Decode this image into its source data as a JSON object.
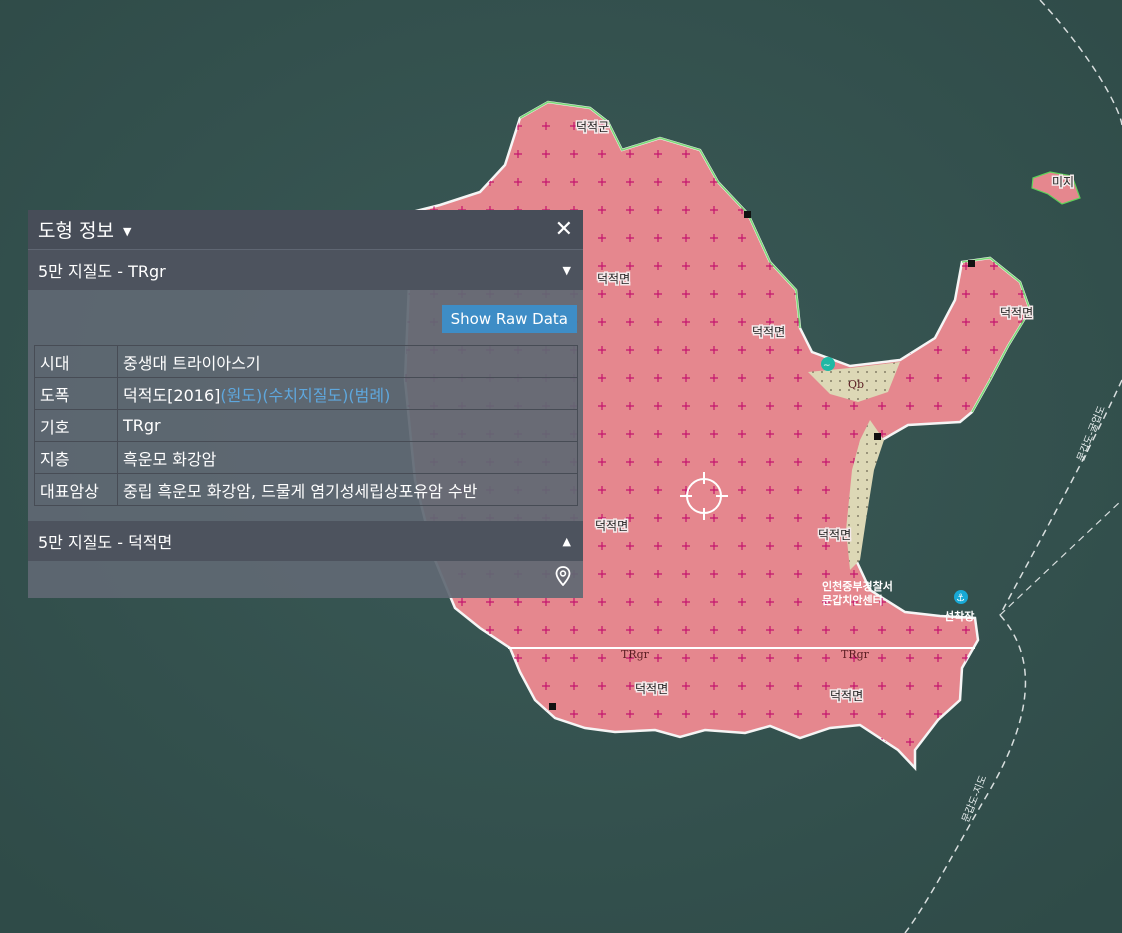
{
  "map": {
    "place_labels": [
      "덕적군",
      "덕적면",
      "덕적면",
      "덕적면",
      "덕적면",
      "덕적면",
      "덕적면",
      "덕적면",
      "덕적면"
    ],
    "unit_labels": [
      "Qb",
      "TRgr",
      "TRgr"
    ],
    "island_label": "미지",
    "ferry_route_1": "문갑도-굴업도",
    "ferry_route_2": "문갑도-지도",
    "poi_labels": [
      "인천중부경찰서",
      "문갑치안센터",
      "선착장"
    ],
    "colors": {
      "sea": "#34524f",
      "granite": "#e5878e",
      "beach": "#ddd8b6",
      "cross": "#c4146d"
    }
  },
  "panel": {
    "title": "도형 정보",
    "section_active": "5만 지질도 - TRgr",
    "raw_button": "Show Raw Data",
    "rows": [
      {
        "key": "시대",
        "value": "중생대 트라이아스기"
      },
      {
        "key": "도폭",
        "value": "덕적도[2016]",
        "links": [
          "(원도)",
          "(수치지질도)",
          "(범례)"
        ]
      },
      {
        "key": "기호",
        "value": "TRgr"
      },
      {
        "key": "지층",
        "value": "흑운모 화강암"
      },
      {
        "key": "대표암상",
        "value": "중립 흑운모 화강암, 드물게 염기성세립상포유암 수반"
      }
    ],
    "section_collapsed": "5만 지질도 - 덕적면"
  }
}
